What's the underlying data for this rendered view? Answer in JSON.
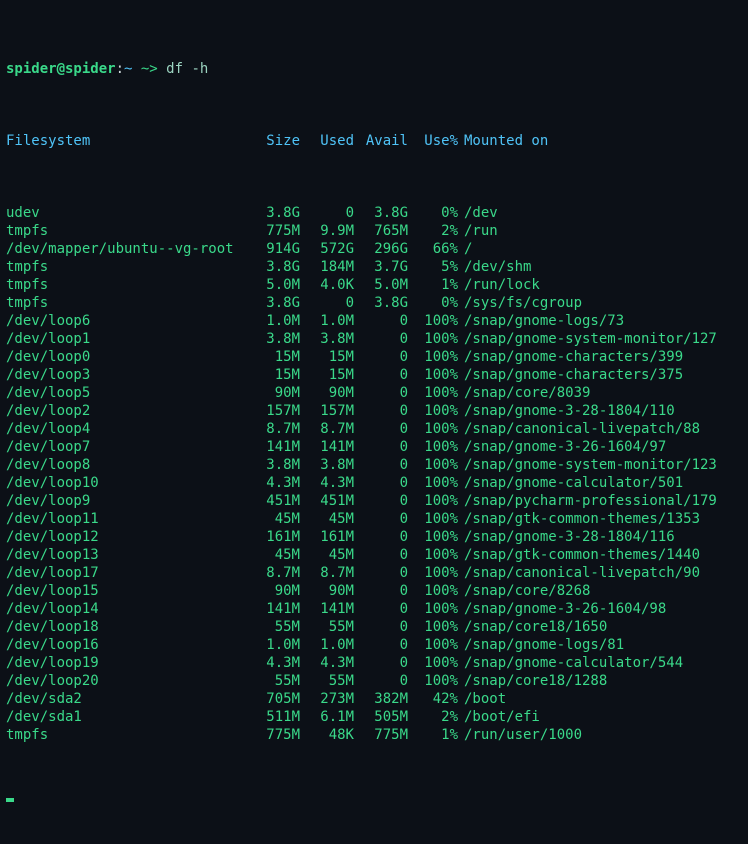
{
  "prompt": {
    "user": "spider@spider",
    "colon": ":",
    "path": "~",
    "arrow": " ~> ",
    "command": "df -h"
  },
  "header": {
    "filesystem": "Filesystem",
    "size": "Size",
    "used": "Used",
    "avail": "Avail",
    "usep": "Use%",
    "mounted": "Mounted on"
  },
  "rows": [
    {
      "filesystem": "udev",
      "size": "3.8G",
      "used": "0",
      "avail": "3.8G",
      "usep": "0%",
      "mounted": "/dev"
    },
    {
      "filesystem": "tmpfs",
      "size": "775M",
      "used": "9.9M",
      "avail": "765M",
      "usep": "2%",
      "mounted": "/run"
    },
    {
      "filesystem": "/dev/mapper/ubuntu--vg-root",
      "size": "914G",
      "used": "572G",
      "avail": "296G",
      "usep": "66%",
      "mounted": "/"
    },
    {
      "filesystem": "tmpfs",
      "size": "3.8G",
      "used": "184M",
      "avail": "3.7G",
      "usep": "5%",
      "mounted": "/dev/shm"
    },
    {
      "filesystem": "tmpfs",
      "size": "5.0M",
      "used": "4.0K",
      "avail": "5.0M",
      "usep": "1%",
      "mounted": "/run/lock"
    },
    {
      "filesystem": "tmpfs",
      "size": "3.8G",
      "used": "0",
      "avail": "3.8G",
      "usep": "0%",
      "mounted": "/sys/fs/cgroup"
    },
    {
      "filesystem": "/dev/loop6",
      "size": "1.0M",
      "used": "1.0M",
      "avail": "0",
      "usep": "100%",
      "mounted": "/snap/gnome-logs/73"
    },
    {
      "filesystem": "/dev/loop1",
      "size": "3.8M",
      "used": "3.8M",
      "avail": "0",
      "usep": "100%",
      "mounted": "/snap/gnome-system-monitor/127"
    },
    {
      "filesystem": "/dev/loop0",
      "size": "15M",
      "used": "15M",
      "avail": "0",
      "usep": "100%",
      "mounted": "/snap/gnome-characters/399"
    },
    {
      "filesystem": "/dev/loop3",
      "size": "15M",
      "used": "15M",
      "avail": "0",
      "usep": "100%",
      "mounted": "/snap/gnome-characters/375"
    },
    {
      "filesystem": "/dev/loop5",
      "size": "90M",
      "used": "90M",
      "avail": "0",
      "usep": "100%",
      "mounted": "/snap/core/8039"
    },
    {
      "filesystem": "/dev/loop2",
      "size": "157M",
      "used": "157M",
      "avail": "0",
      "usep": "100%",
      "mounted": "/snap/gnome-3-28-1804/110"
    },
    {
      "filesystem": "/dev/loop4",
      "size": "8.7M",
      "used": "8.7M",
      "avail": "0",
      "usep": "100%",
      "mounted": "/snap/canonical-livepatch/88"
    },
    {
      "filesystem": "/dev/loop7",
      "size": "141M",
      "used": "141M",
      "avail": "0",
      "usep": "100%",
      "mounted": "/snap/gnome-3-26-1604/97"
    },
    {
      "filesystem": "/dev/loop8",
      "size": "3.8M",
      "used": "3.8M",
      "avail": "0",
      "usep": "100%",
      "mounted": "/snap/gnome-system-monitor/123"
    },
    {
      "filesystem": "/dev/loop10",
      "size": "4.3M",
      "used": "4.3M",
      "avail": "0",
      "usep": "100%",
      "mounted": "/snap/gnome-calculator/501"
    },
    {
      "filesystem": "/dev/loop9",
      "size": "451M",
      "used": "451M",
      "avail": "0",
      "usep": "100%",
      "mounted": "/snap/pycharm-professional/179"
    },
    {
      "filesystem": "/dev/loop11",
      "size": "45M",
      "used": "45M",
      "avail": "0",
      "usep": "100%",
      "mounted": "/snap/gtk-common-themes/1353"
    },
    {
      "filesystem": "/dev/loop12",
      "size": "161M",
      "used": "161M",
      "avail": "0",
      "usep": "100%",
      "mounted": "/snap/gnome-3-28-1804/116"
    },
    {
      "filesystem": "/dev/loop13",
      "size": "45M",
      "used": "45M",
      "avail": "0",
      "usep": "100%",
      "mounted": "/snap/gtk-common-themes/1440"
    },
    {
      "filesystem": "/dev/loop17",
      "size": "8.7M",
      "used": "8.7M",
      "avail": "0",
      "usep": "100%",
      "mounted": "/snap/canonical-livepatch/90"
    },
    {
      "filesystem": "/dev/loop15",
      "size": "90M",
      "used": "90M",
      "avail": "0",
      "usep": "100%",
      "mounted": "/snap/core/8268"
    },
    {
      "filesystem": "/dev/loop14",
      "size": "141M",
      "used": "141M",
      "avail": "0",
      "usep": "100%",
      "mounted": "/snap/gnome-3-26-1604/98"
    },
    {
      "filesystem": "/dev/loop18",
      "size": "55M",
      "used": "55M",
      "avail": "0",
      "usep": "100%",
      "mounted": "/snap/core18/1650"
    },
    {
      "filesystem": "/dev/loop16",
      "size": "1.0M",
      "used": "1.0M",
      "avail": "0",
      "usep": "100%",
      "mounted": "/snap/gnome-logs/81"
    },
    {
      "filesystem": "/dev/loop19",
      "size": "4.3M",
      "used": "4.3M",
      "avail": "0",
      "usep": "100%",
      "mounted": "/snap/gnome-calculator/544"
    },
    {
      "filesystem": "/dev/loop20",
      "size": "55M",
      "used": "55M",
      "avail": "0",
      "usep": "100%",
      "mounted": "/snap/core18/1288"
    },
    {
      "filesystem": "/dev/sda2",
      "size": "705M",
      "used": "273M",
      "avail": "382M",
      "usep": "42%",
      "mounted": "/boot"
    },
    {
      "filesystem": "/dev/sda1",
      "size": "511M",
      "used": "6.1M",
      "avail": "505M",
      "usep": "2%",
      "mounted": "/boot/efi"
    },
    {
      "filesystem": "tmpfs",
      "size": "775M",
      "used": "48K",
      "avail": "775M",
      "usep": "1%",
      "mounted": "/run/user/1000"
    }
  ]
}
